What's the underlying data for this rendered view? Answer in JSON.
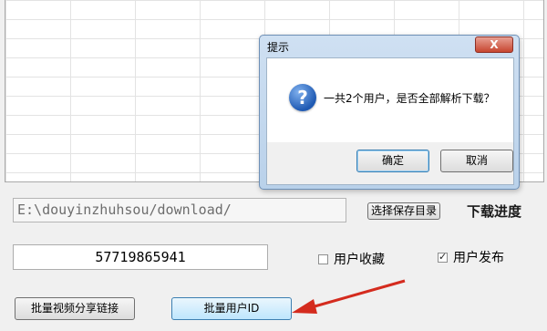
{
  "main": {
    "save_path": "E:\\douyinzhuhsou/download/",
    "choose_dir_label": "选择保存目录",
    "progress_label": "下载进度",
    "user_id_value": "57719865941",
    "favorites_label": "用户收藏",
    "favorites_checked": false,
    "published_label": "用户发布",
    "published_checked": true,
    "batch_video_label": "批量视频分享链接",
    "batch_user_label": "批量用户ID"
  },
  "dialog": {
    "title": "提示",
    "close_label": "X",
    "icon": "question-icon",
    "message": "一共2个用户，是否全部解析下载？",
    "ok_label": "确定",
    "cancel_label": "取消"
  },
  "colors": {
    "arrow": "#d42b1e",
    "dialog_frame": "#b9d1ea",
    "close_button": "#c7452f"
  }
}
